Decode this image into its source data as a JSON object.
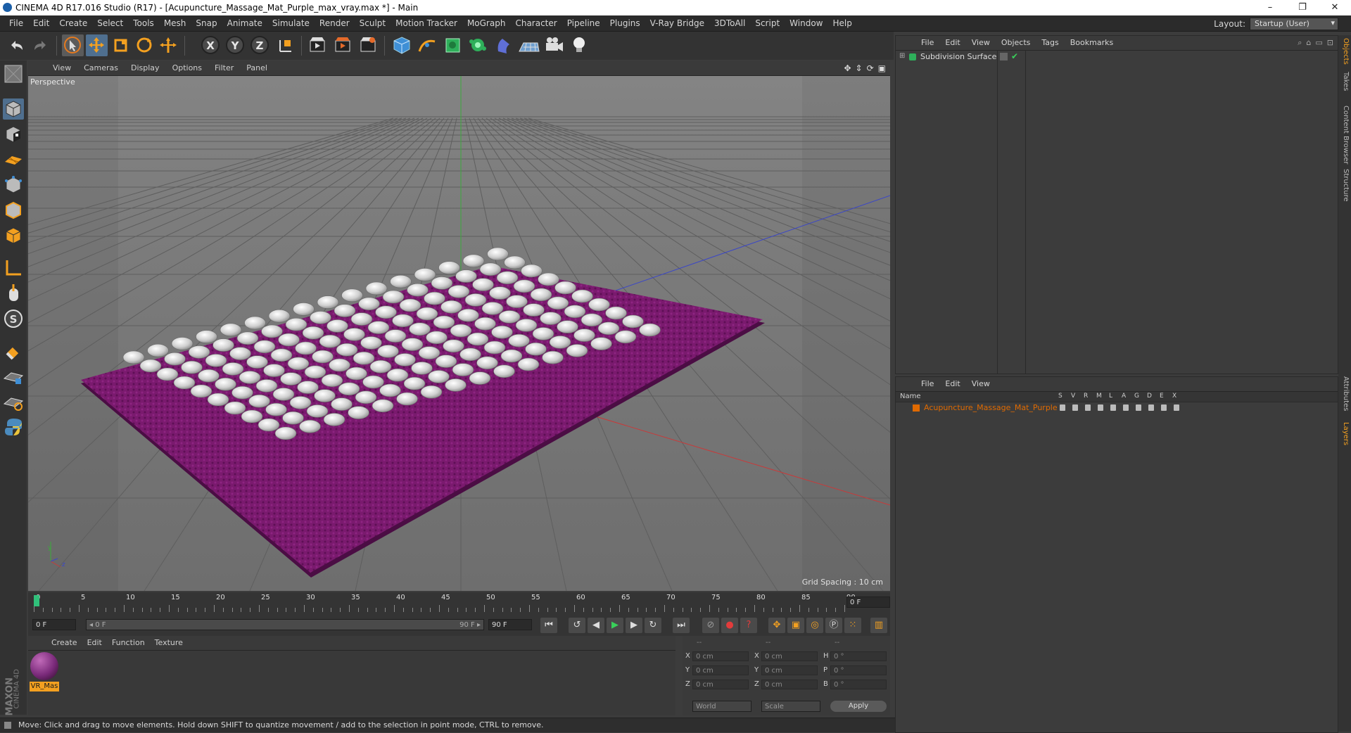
{
  "window": {
    "title": "CINEMA 4D R17.016 Studio (R17) - [Acupuncture_Massage_Mat_Purple_max_vray.max *] - Main",
    "minimize": "–",
    "maximize": "❐",
    "close": "✕"
  },
  "menubar": {
    "items": [
      "File",
      "Edit",
      "Create",
      "Select",
      "Tools",
      "Mesh",
      "Snap",
      "Animate",
      "Simulate",
      "Render",
      "Sculpt",
      "Motion Tracker",
      "MoGraph",
      "Character",
      "Pipeline",
      "Plugins",
      "V-Ray Bridge",
      "3DToAll",
      "Script",
      "Window",
      "Help"
    ],
    "layout_label": "Layout:",
    "layout_value": "Startup (User)"
  },
  "viewport": {
    "menu": [
      "View",
      "Cameras",
      "Display",
      "Options",
      "Filter",
      "Panel"
    ],
    "camera_label": "Perspective",
    "grid_spacing": "Grid Spacing : 10 cm",
    "axis_y": "y",
    "axis_z": "z"
  },
  "timeline": {
    "ticks": [
      "0",
      "5",
      "10",
      "15",
      "20",
      "25",
      "30",
      "35",
      "40",
      "45",
      "50",
      "55",
      "60",
      "65",
      "70",
      "75",
      "80",
      "85",
      "90"
    ],
    "current_frame_right": "0 F",
    "start_field": "0 F",
    "range_start": "◂ 0 F",
    "range_end": "90 F ▸",
    "end_field": "90 F"
  },
  "material_manager": {
    "menu": [
      "Create",
      "Edit",
      "Function",
      "Texture"
    ],
    "materials": [
      {
        "name": "VR_Mas",
        "color": "#7a2a7a"
      }
    ]
  },
  "coordinates": {
    "header": [
      "--",
      "--",
      "--"
    ],
    "rows": [
      {
        "a_label": "X",
        "a_val": "0 cm",
        "b_label": "X",
        "b_val": "0 cm",
        "c_label": "H",
        "c_val": "0 °"
      },
      {
        "a_label": "Y",
        "a_val": "0 cm",
        "b_label": "Y",
        "b_val": "0 cm",
        "c_label": "P",
        "c_val": "0 °"
      },
      {
        "a_label": "Z",
        "a_val": "0 cm",
        "b_label": "Z",
        "b_val": "0 cm",
        "c_label": "B",
        "c_val": "0 °"
      }
    ],
    "mode1": "World",
    "mode2": "Scale",
    "apply": "Apply"
  },
  "object_manager": {
    "menu": [
      "File",
      "Edit",
      "View",
      "Objects",
      "Tags",
      "Bookmarks"
    ],
    "objects": [
      {
        "name": "Subdivision Surface"
      }
    ]
  },
  "layer_manager": {
    "menu": [
      "File",
      "Edit",
      "View"
    ],
    "columns": {
      "name": "Name",
      "flags": [
        "S",
        "V",
        "R",
        "M",
        "L",
        "A",
        "G",
        "D",
        "E",
        "X"
      ]
    },
    "layers": [
      {
        "name": "Acupuncture_Massage_Mat_Purple",
        "color": "#e06a00"
      }
    ]
  },
  "side_tabs": [
    "Objects",
    "Takes",
    "Content Browser",
    "Structure",
    "Attributes",
    "Layers"
  ],
  "branding": {
    "line1": "MAXON",
    "line2": "CINEMA 4D"
  },
  "status": "Move: Click and drag to move elements. Hold down SHIFT to quantize movement / add to the selection in point mode, CTRL to remove.",
  "colors": {
    "accent": "#3f8fd6",
    "mat_purple": "#7a1a6e",
    "layer_orange": "#e06a00"
  }
}
